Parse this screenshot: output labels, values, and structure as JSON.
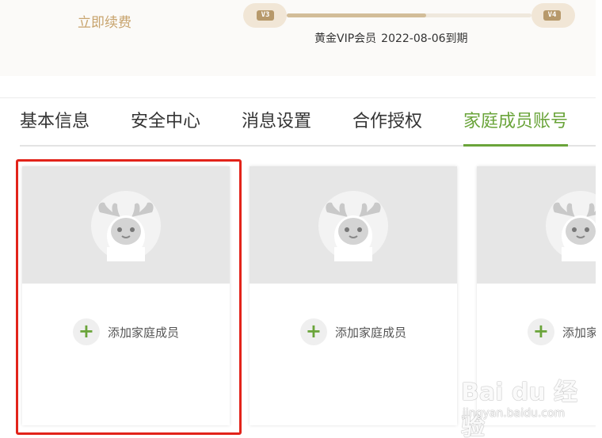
{
  "vip": {
    "renew_label": "立即续费",
    "current_level": "V3",
    "next_level": "V4",
    "progress_fraction": 0.57,
    "member_type": "黄金VIP会员",
    "expiry": "2022-08-06到期"
  },
  "tabs": [
    {
      "label": "基本信息",
      "active": false
    },
    {
      "label": "安全中心",
      "active": false
    },
    {
      "label": "消息设置",
      "active": false
    },
    {
      "label": "合作授权",
      "active": false
    },
    {
      "label": "家庭成员账号",
      "active": true
    }
  ],
  "cards": [
    {
      "add_label": "添加家庭成员",
      "avatar_icon": "deer-avatar-icon",
      "plus_icon": "plus-icon"
    },
    {
      "add_label": "添加家庭成员",
      "avatar_icon": "deer-avatar-icon",
      "plus_icon": "plus-icon"
    },
    {
      "add_label": "添加家庭成员",
      "avatar_icon": "deer-avatar-icon",
      "plus_icon": "plus-icon"
    }
  ],
  "colors": {
    "accent_green": "#6aa43a",
    "gold": "#c8a46e",
    "highlight_red": "#e2231a"
  },
  "watermark": {
    "main": "Bai du 经验",
    "sub": "jingyan.baidu.com"
  }
}
